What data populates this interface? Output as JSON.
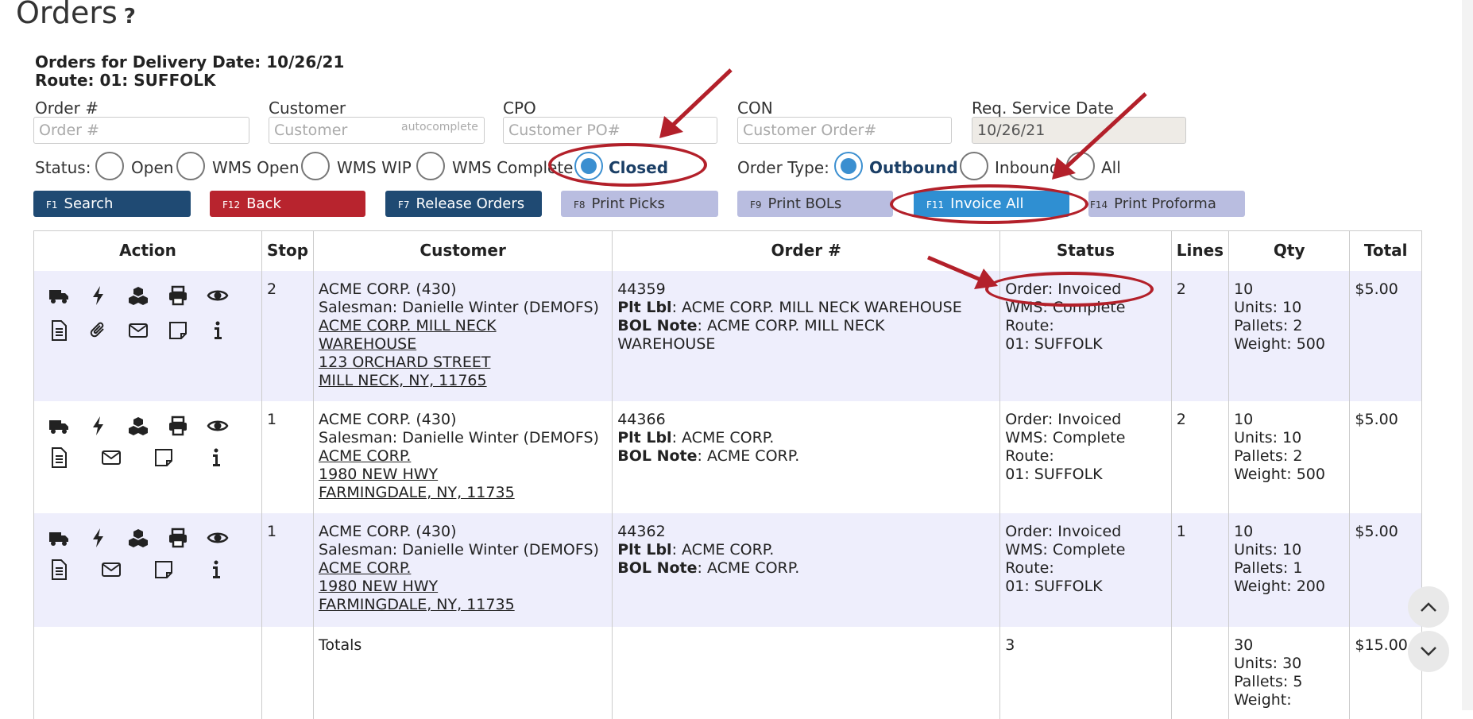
{
  "page": {
    "title": "Orders",
    "help": "?"
  },
  "subheader": {
    "line1": "Orders for Delivery Date: 10/26/21",
    "line2": "Route: 01: SUFFOLK"
  },
  "filters": {
    "order_label": "Order #",
    "order_placeholder": "Order #",
    "customer_label": "Customer",
    "customer_placeholder": "Customer",
    "customer_tag": "autocomplete",
    "cpo_label": "CPO",
    "cpo_placeholder": "Customer PO#",
    "con_label": "CON",
    "con_placeholder": "Customer Order#",
    "req_label": "Req. Service Date",
    "req_value": "10/26/21"
  },
  "status": {
    "label": "Status:",
    "options": [
      "Open",
      "WMS Open",
      "WMS WIP",
      "WMS Complete",
      "Closed"
    ],
    "selected": "Closed"
  },
  "order_type": {
    "label": "Order Type:",
    "options": [
      "Outbound",
      "Inbound",
      "All"
    ],
    "selected": "Outbound"
  },
  "buttons": [
    {
      "key": "F1",
      "label": "Search"
    },
    {
      "key": "F12",
      "label": "Back"
    },
    {
      "key": "F7",
      "label": "Release Orders"
    },
    {
      "key": "F8",
      "label": "Print Picks"
    },
    {
      "key": "F9",
      "label": "Print BOLs"
    },
    {
      "key": "F11",
      "label": "Invoice All"
    },
    {
      "key": "F14",
      "label": "Print Proforma"
    }
  ],
  "table": {
    "headers": [
      "Action",
      "Stop",
      "Customer",
      "Order #",
      "Status",
      "Lines",
      "Qty",
      "Total"
    ],
    "rows": [
      {
        "stop": "2",
        "customer": "ACME CORP. (430)",
        "salesman": "Salesman: Danielle Winter (DEMOFS)",
        "addr1": "ACME CORP. MILL NECK",
        "addr2": "WAREHOUSE",
        "addr3": "123 ORCHARD STREET",
        "addr4": "MILL NECK, NY, 11765",
        "order": "44359",
        "plt_label": "Plt Lbl",
        "plt": ": ACME CORP. MILL NECK WAREHOUSE",
        "bol_label": "BOL Note",
        "bol": ": ACME CORP. MILL NECK",
        "bol2": "WAREHOUSE",
        "status1": "Order: Invoiced",
        "status2": "WMS: Complete",
        "status3": "Route:",
        "status4": "01: SUFFOLK",
        "lines": "2",
        "qty": "10",
        "units": "Units: 10",
        "pallets": "Pallets: 2",
        "weight": "Weight: 500",
        "total": "$5.00"
      },
      {
        "stop": "1",
        "customer": "ACME CORP. (430)",
        "salesman": "Salesman: Danielle Winter (DEMOFS)",
        "addr1": "ACME CORP.",
        "addr2": "1980 NEW HWY",
        "addr3": "FARMINGDALE, NY, 11735",
        "addr4": "",
        "order": "44366",
        "plt_label": "Plt Lbl",
        "plt": ": ACME CORP.",
        "bol_label": "BOL Note",
        "bol": ": ACME CORP.",
        "bol2": "",
        "status1": "Order: Invoiced",
        "status2": "WMS: Complete",
        "status3": "Route:",
        "status4": "01: SUFFOLK",
        "lines": "2",
        "qty": "10",
        "units": "Units: 10",
        "pallets": "Pallets: 2",
        "weight": "Weight: 500",
        "total": "$5.00"
      },
      {
        "stop": "1",
        "customer": "ACME CORP. (430)",
        "salesman": "Salesman: Danielle Winter (DEMOFS)",
        "addr1": "ACME CORP.",
        "addr2": "1980 NEW HWY",
        "addr3": "FARMINGDALE, NY, 11735",
        "addr4": "",
        "order": "44362",
        "plt_label": "Plt Lbl",
        "plt": ": ACME CORP.",
        "bol_label": "BOL Note",
        "bol": ": ACME CORP.",
        "bol2": "",
        "status1": "Order: Invoiced",
        "status2": "WMS: Complete",
        "status3": "Route:",
        "status4": "01: SUFFOLK",
        "lines": "1",
        "qty": "10",
        "units": "Units: 10",
        "pallets": "Pallets: 1",
        "weight": "Weight: 200",
        "total": "$5.00"
      }
    ],
    "totals": {
      "label": "Totals",
      "lines": "3",
      "qty": "30",
      "units": "Units: 30",
      "pallets": "Pallets: 5",
      "weight": "Weight:",
      "total": "$15.00"
    }
  },
  "colors": {
    "navy": "#1f4a73",
    "red": "#b8242e",
    "lavender": "#b9bde0",
    "blue": "#2f8fd2",
    "annotation": "#b3202a"
  }
}
